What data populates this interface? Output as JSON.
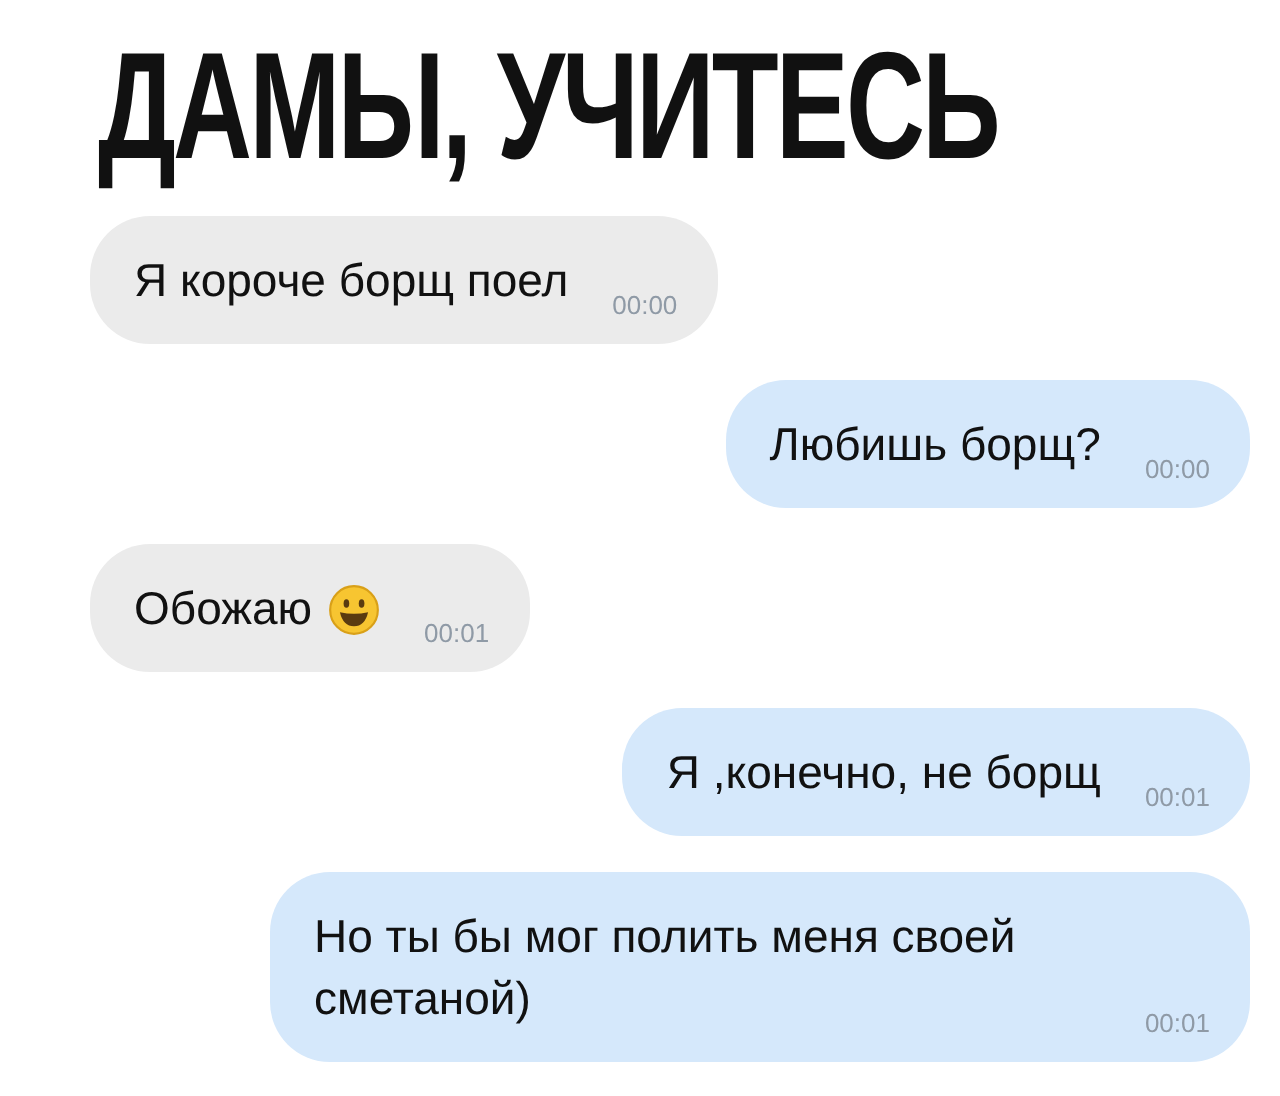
{
  "title": "ДАМЫ, УЧИТЕСЬ",
  "messages": [
    {
      "kind": "incoming",
      "text": "Я короче борщ поел",
      "emoji": false,
      "time": "00:00"
    },
    {
      "kind": "outgoing",
      "text": "Любишь борщ?",
      "emoji": false,
      "time": "00:00"
    },
    {
      "kind": "incoming",
      "text": "Обожаю",
      "emoji": true,
      "time": "00:01"
    },
    {
      "kind": "outgoing",
      "text": "Я ,конечно, не борщ",
      "emoji": false,
      "time": "00:01"
    },
    {
      "kind": "outgoing",
      "text": "Но ты бы мог полить меня своей сметаной)",
      "emoji": false,
      "time": "00:01"
    }
  ]
}
